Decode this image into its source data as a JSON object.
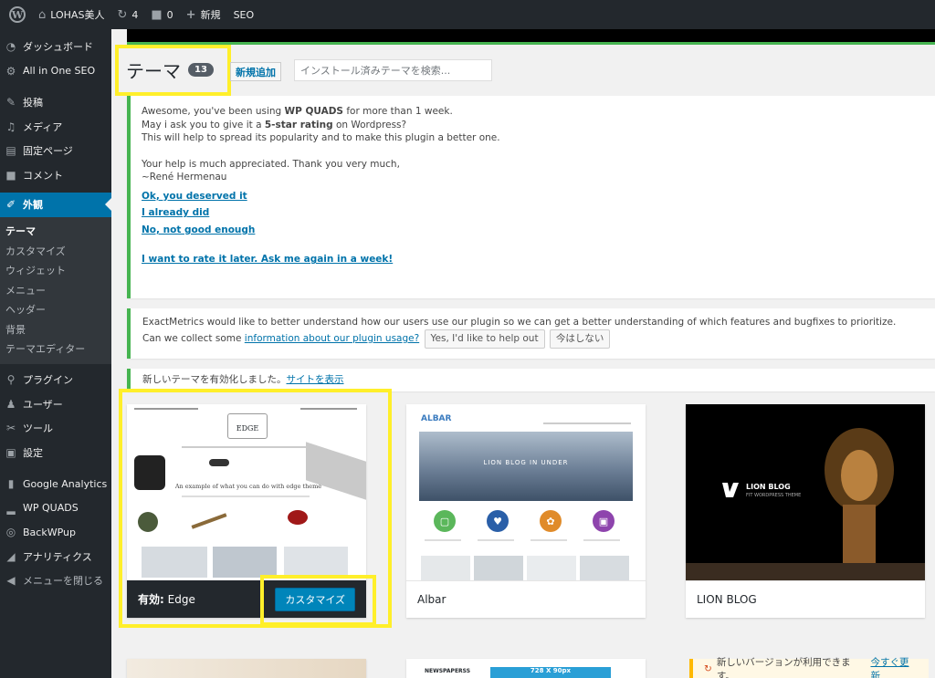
{
  "admin_bar": {
    "site_name": "LOHAS美人",
    "updates_count": "4",
    "comments_count": "0",
    "new_label": "新規",
    "seo_label": "SEO"
  },
  "sidebar": {
    "items": [
      {
        "label": "ダッシュボード",
        "icon": "dashboard-icon"
      },
      {
        "label": "All in One SEO",
        "icon": "gear-icon"
      },
      {
        "label": "投稿",
        "icon": "pin-icon"
      },
      {
        "label": "メディア",
        "icon": "media-icon"
      },
      {
        "label": "固定ページ",
        "icon": "page-icon"
      },
      {
        "label": "コメント",
        "icon": "comment-icon"
      },
      {
        "label": "外観",
        "icon": "brush-icon"
      },
      {
        "label": "プラグイン",
        "icon": "plugin-icon"
      },
      {
        "label": "ユーザー",
        "icon": "user-icon"
      },
      {
        "label": "ツール",
        "icon": "wrench-icon"
      },
      {
        "label": "設定",
        "icon": "settings-icon"
      },
      {
        "label": "Google Analytics",
        "icon": "bar-chart-icon"
      },
      {
        "label": "WP QUADS",
        "icon": "signal-icon"
      },
      {
        "label": "BackWPup",
        "icon": "backup-icon"
      },
      {
        "label": "アナリティクス",
        "icon": "analytics-icon"
      },
      {
        "label": "メニューを閉じる",
        "icon": "collapse-icon"
      }
    ],
    "appearance_sub": [
      "テーマ",
      "カスタマイズ",
      "ウィジェット",
      "メニュー",
      "ヘッダー",
      "背景",
      "テーマエディター"
    ]
  },
  "header": {
    "title": "テーマ",
    "count": "13",
    "add_new": "新規追加",
    "search_placeholder": "インストール済みテーマを検索..."
  },
  "quads_notice": {
    "line1_pre": "Awesome, you've been using ",
    "line1_bold": "WP QUADS",
    "line1_post": " for more than 1 week.",
    "line2_pre": "May i ask you to give it a ",
    "line2_bold": "5-star rating",
    "line2_post": " on Wordpress?",
    "line3": "This will help to spread its popularity and to make this plugin a better one.",
    "line4": "Your help is much appreciated. Thank you very much,",
    "line5": "~René Hermenau",
    "link1": "Ok, you deserved it",
    "link2": "I already did",
    "link3": "No, not good enough",
    "link4": "I want to rate it later. Ask me again in a week!"
  },
  "em_notice": {
    "line1": "ExactMetrics would like to better understand how our users use our plugin so we can get a better understanding of which features and bugfixes to prioritize.",
    "line2_pre": "Can we collect some ",
    "line2_link": "information about our plugin usage?",
    "btn_yes": "Yes, I'd like to help out",
    "btn_no": "今はしない"
  },
  "activated_notice": {
    "text": "新しいテーマを有効化しました。",
    "link": "サイトを表示"
  },
  "themes": [
    {
      "name": "Edge",
      "active_label": "有効:",
      "customize": "カスタマイズ"
    },
    {
      "name": "Albar"
    },
    {
      "name": "LION BLOG"
    }
  ],
  "theme_shots": {
    "edge": {
      "logo": "EDGE",
      "tagline": "An example of what you can do with edge theme"
    },
    "albar": {
      "logo": "ALBAR",
      "hero": "LION BLOG IN UNDER"
    },
    "lion": {
      "title": "LION BLOG",
      "sub": "FIT WORDPRESS THEME"
    },
    "news": {
      "label": "NEWSPAPERSS",
      "ad": "728 X 90px"
    }
  },
  "update_notice": {
    "text": "新しいバージョンが利用できます。",
    "link": "今すぐ更新"
  },
  "colors": {
    "admin_dark": "#23282d",
    "accent_blue": "#0073aa",
    "success_green": "#46b450",
    "highlight_yellow": "#ffef2a"
  }
}
